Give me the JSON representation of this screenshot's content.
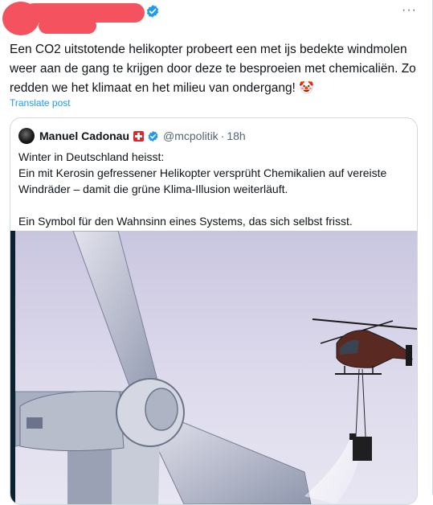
{
  "tweet": {
    "text": "Een CO2 uitstotende helikopter probeert een met ijs bedekte windmolen weer aan de gang te krijgen door deze te besproeien met chemicaliën. Zo redden we het klimaat en het milieu van ondergang!",
    "emoji": "🤡",
    "translate_label": "Translate post",
    "more_label": "···"
  },
  "quote": {
    "author_name": "Manuel Cadonau",
    "handle": "@mcpolitik",
    "separator": "·",
    "time": "18h",
    "line1": "Winter in Deutschland heisst:",
    "line2": "Ein mit Kerosin gefressener Helikopter versprüht Chemikalien auf vereiste Windräder – damit die grüne Klima-Illusion weiterläuft.",
    "line3": "Ein Symbol für den Wahnsinn eines Systems, das sich selbst frisst."
  },
  "colors": {
    "link_blue": "#1d9bf0",
    "redaction_red": "#f4525f",
    "swiss_flag_red": "#e0262b"
  },
  "icons": [
    "verified-badge-icon",
    "more-options-icon",
    "swiss-flag-icon",
    "avatar"
  ]
}
